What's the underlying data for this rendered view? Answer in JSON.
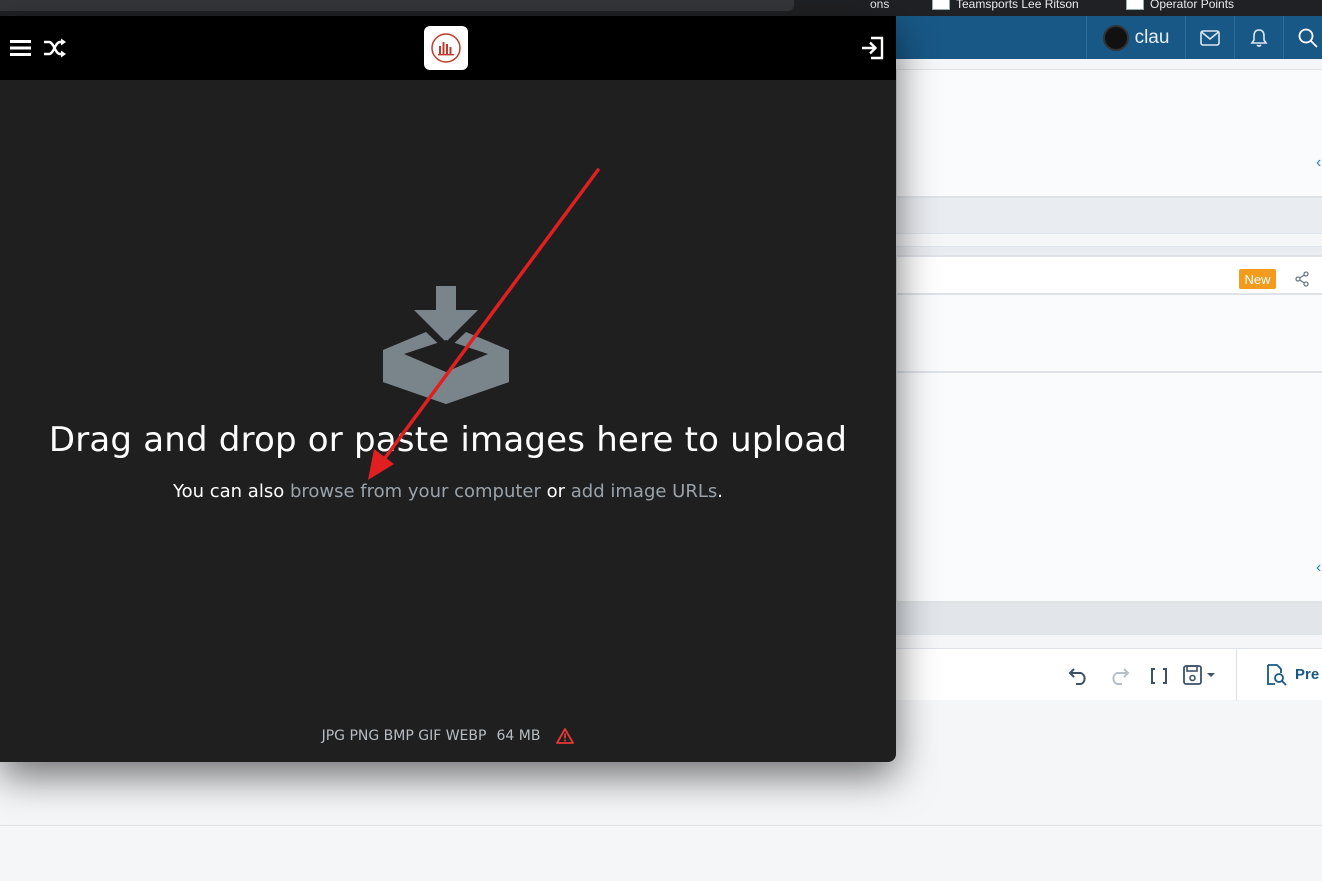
{
  "browser": {
    "bookmarks": [
      {
        "label": "ons"
      },
      {
        "label": "Teamsports Lee Ritson"
      },
      {
        "label": "Operator Points"
      }
    ]
  },
  "forum": {
    "username": "clau",
    "new_badge": "New",
    "preview_label": "Pre"
  },
  "uploader": {
    "headline": "Drag and drop or paste images here to upload",
    "subline_prefix": "You can also ",
    "browse_link": "browse from your computer",
    "subline_or": " or ",
    "url_link": "add image URLs",
    "subline_suffix": ".",
    "formats": "JPG PNG BMP GIF WEBP",
    "max_size": "64 MB",
    "icons": [
      "menu-icon",
      "shuffle-icon",
      "logo",
      "sign-in-icon",
      "upload-tray-icon",
      "warning-icon"
    ]
  },
  "annotation": {
    "arrow_color": "#e02020"
  },
  "colors": {
    "modal_bg": "#1f1f1f",
    "forum_header": "#185886",
    "badge_new": "#f29b1c",
    "warning": "#e53935"
  }
}
